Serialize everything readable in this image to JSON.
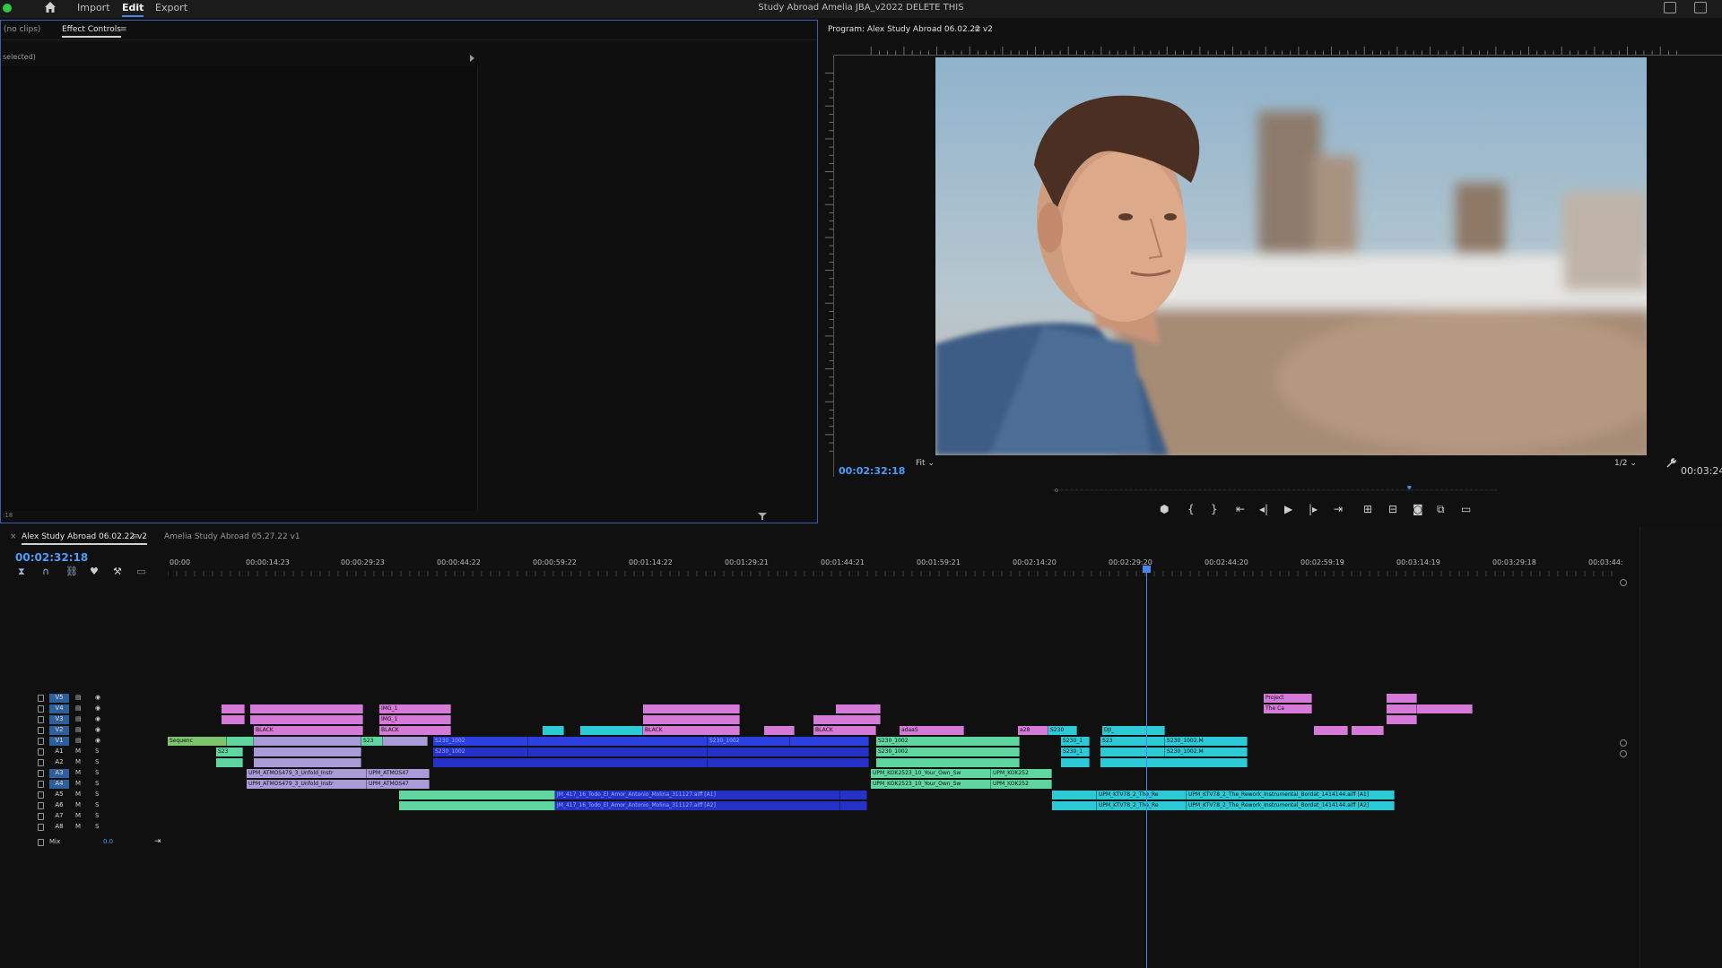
{
  "topbar": {
    "nav": [
      "Import",
      "Edit",
      "Export"
    ],
    "active": "Edit",
    "title": "Study Abroad Amelia JBA_v2022 DELETE THIS"
  },
  "effect_controls": {
    "tab_inactive": "(no clips)",
    "tab_active": "Effect Controls",
    "menu": "≡",
    "subheader": "selected)",
    "footer": ":18"
  },
  "program": {
    "title": "Program: Alex Study Abroad 06.02.22 v2",
    "menu": "≡",
    "timecode": "00:02:32:18",
    "fit": "Fit",
    "resolution": "1/2",
    "duration": "00:03:24",
    "playhead_fraction": 0.81
  },
  "timeline": {
    "tabs": [
      "Alex Study Abroad 06.02.22 v2",
      "Amelia Study Abroad 05.27.22 v1"
    ],
    "tab_close": "×",
    "menu": "≡",
    "timecode": "00:02:32:18",
    "time_labels": [
      "00:00",
      "00:00:14:23",
      "00:00:29:23",
      "00:00:44:22",
      "00:00:59:22",
      "00:01:14:22",
      "00:01:29:21",
      "00:01:44:21",
      "00:01:59:21",
      "00:02:14:20",
      "00:02:29:20",
      "00:02:44:20",
      "00:02:59:19",
      "00:03:14:19",
      "00:03:29:18",
      "00:03:44:"
    ],
    "video_tracks": [
      "V5",
      "V4",
      "V3",
      "V2",
      "V1"
    ],
    "audio_tracks": [
      "A1",
      "A2",
      "A3",
      "A4",
      "A5",
      "A6",
      "A7",
      "A8"
    ],
    "mix_label": "Mix",
    "mix_value": "0.0",
    "clips": {
      "v4a": "IMG_1",
      "v3a": "IMG_1",
      "v2a": "BLACK",
      "v2b": "BLACK",
      "v2c": "BLACK",
      "v2d": "BLACK",
      "v2e": "adaaS",
      "v2f": "a28",
      "v2g": "S230",
      "v2h": "DJI_",
      "v1a": "Sequenc",
      "v1b": "S23",
      "v1c": "S230_1002",
      "v1d": "S230_1002",
      "v1e": "S230_1002",
      "v1f": "S230_1",
      "v1g": "S23",
      "v1h": "S230_1002.M",
      "v5a": "Project",
      "v4b": "The Ca",
      "a1a": "S23",
      "a1b": "S230_1002",
      "a1c": "S230_1002",
      "a1d": "S230_1",
      "a1e": "S230_1002.M",
      "a3a": "UPM_ATMOS479_3_Unfold_Instr",
      "a3b": "UPM_ATMOS47",
      "a3c": "UPM_KOK2523_10_Your_Own_Sw",
      "a3d": "UPM_KOK252",
      "a4a": "UPM_ATMOS479_3_Unfold_Instr",
      "a4b": "UPM_ATMOS47",
      "a4c": "UPM_KOK2523_10_Your_Own_Sw",
      "a4d": "UPM_KOK252",
      "a5a": "JM_417_16_Todo_El_Amor_Antonio_Molina_311127.aiff [A1]",
      "a5b": "UPM_KTV78_2_The_Re",
      "a5c": "UPM_KTV78_2_The_Rework_Instrumental_Bordat_1414144.aiff [A1]",
      "a6a": "JM_417_16_Todo_El_Amor_Antonio_Molina_311127.aiff [A2]",
      "a6b": "UPM_KTV78_2_The_Re",
      "a6c": "UPM_KTV78_2_The_Rework_Instrumental_Bordat_1414144.aiff [A2]"
    }
  },
  "icons": [
    "home-icon",
    "menu-icon",
    "filter-icon",
    "wrench-icon",
    "play-icon",
    "camera-icon",
    "snap-icon",
    "marker-icon",
    "lock-icon",
    "eye-icon"
  ],
  "colors": {
    "accent": "#4a86e8",
    "clip_pink": "#d57ad8",
    "clip_green": "#5fd6a0",
    "clip_blue": "#2c3fe0",
    "clip_teal": "#2cc9d6",
    "clip_lavender": "#a99ad8"
  }
}
